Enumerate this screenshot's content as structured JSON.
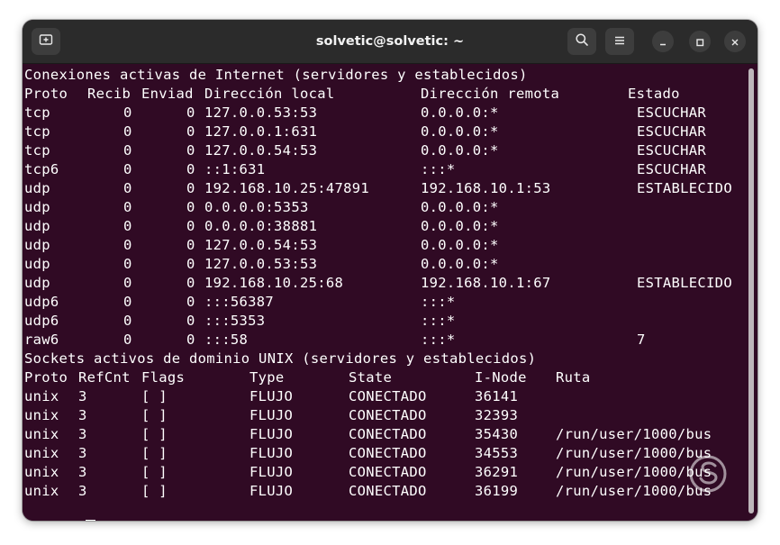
{
  "window": {
    "title": "solvetic@solvetic: ~"
  },
  "titlebar": {
    "new_tab_icon": "new-tab-icon",
    "search_icon": "search-icon",
    "menu_icon": "hamburger-menu-icon",
    "minimize_icon": "minimize-icon",
    "maximize_icon": "maximize-icon",
    "close_icon": "close-icon"
  },
  "colors": {
    "terminal_bg": "#300a24",
    "titlebar_bg": "#2b2b2b",
    "text": "#ffffff"
  },
  "internet": {
    "heading": "Conexiones activas de Internet (servidores y establecidos)",
    "headers": {
      "proto": "Proto",
      "recib": "Recib",
      "enviad": "Enviad",
      "local": "Dirección local",
      "remote": "Dirección remota",
      "state": "Estado"
    },
    "rows": [
      {
        "proto": "tcp",
        "recib": "0",
        "enviad": "0",
        "local": "127.0.0.53:53",
        "remote": "0.0.0.0:*",
        "state": "ESCUCHAR"
      },
      {
        "proto": "tcp",
        "recib": "0",
        "enviad": "0",
        "local": "127.0.0.1:631",
        "remote": "0.0.0.0:*",
        "state": "ESCUCHAR"
      },
      {
        "proto": "tcp",
        "recib": "0",
        "enviad": "0",
        "local": "127.0.0.54:53",
        "remote": "0.0.0.0:*",
        "state": "ESCUCHAR"
      },
      {
        "proto": "tcp6",
        "recib": "0",
        "enviad": "0",
        "local": "::1:631",
        "remote": ":::*",
        "state": "ESCUCHAR"
      },
      {
        "proto": "udp",
        "recib": "0",
        "enviad": "0",
        "local": "192.168.10.25:47891",
        "remote": "192.168.10.1:53",
        "state": "ESTABLECIDO"
      },
      {
        "proto": "udp",
        "recib": "0",
        "enviad": "0",
        "local": "0.0.0.0:5353",
        "remote": "0.0.0.0:*",
        "state": ""
      },
      {
        "proto": "udp",
        "recib": "0",
        "enviad": "0",
        "local": "0.0.0.0:38881",
        "remote": "0.0.0.0:*",
        "state": ""
      },
      {
        "proto": "udp",
        "recib": "0",
        "enviad": "0",
        "local": "127.0.0.54:53",
        "remote": "0.0.0.0:*",
        "state": ""
      },
      {
        "proto": "udp",
        "recib": "0",
        "enviad": "0",
        "local": "127.0.0.53:53",
        "remote": "0.0.0.0:*",
        "state": ""
      },
      {
        "proto": "udp",
        "recib": "0",
        "enviad": "0",
        "local": "192.168.10.25:68",
        "remote": "192.168.10.1:67",
        "state": "ESTABLECIDO"
      },
      {
        "proto": "udp6",
        "recib": "0",
        "enviad": "0",
        "local": ":::56387",
        "remote": ":::*",
        "state": ""
      },
      {
        "proto": "udp6",
        "recib": "0",
        "enviad": "0",
        "local": ":::5353",
        "remote": ":::*",
        "state": ""
      },
      {
        "proto": "raw6",
        "recib": "0",
        "enviad": "0",
        "local": ":::58",
        "remote": ":::*",
        "state": "7"
      }
    ]
  },
  "unix": {
    "heading": "Sockets activos de dominio UNIX (servidores y establecidos)",
    "headers": {
      "proto": "Proto",
      "refcnt": "RefCnt",
      "flags": "Flags",
      "type": "Type",
      "state": "State",
      "inode": "I-Node",
      "path": "Ruta"
    },
    "rows": [
      {
        "proto": "unix",
        "refcnt": "3",
        "flags": "[ ]",
        "type": "FLUJO",
        "state": "CONECTADO",
        "inode": "36141",
        "path": ""
      },
      {
        "proto": "unix",
        "refcnt": "3",
        "flags": "[ ]",
        "type": "FLUJO",
        "state": "CONECTADO",
        "inode": "32393",
        "path": ""
      },
      {
        "proto": "unix",
        "refcnt": "3",
        "flags": "[ ]",
        "type": "FLUJO",
        "state": "CONECTADO",
        "inode": "35430",
        "path": "/run/user/1000/bus"
      },
      {
        "proto": "unix",
        "refcnt": "3",
        "flags": "[ ]",
        "type": "FLUJO",
        "state": "CONECTADO",
        "inode": "34553",
        "path": "/run/user/1000/bus"
      },
      {
        "proto": "unix",
        "refcnt": "3",
        "flags": "[ ]",
        "type": "FLUJO",
        "state": "CONECTADO",
        "inode": "36291",
        "path": "/run/user/1000/bus"
      },
      {
        "proto": "unix",
        "refcnt": "3",
        "flags": "[ ]",
        "type": "FLUJO",
        "state": "CONECTADO",
        "inode": "36199",
        "path": "/run/user/1000/bus"
      }
    ]
  },
  "prompt": {
    "text": ":"
  }
}
